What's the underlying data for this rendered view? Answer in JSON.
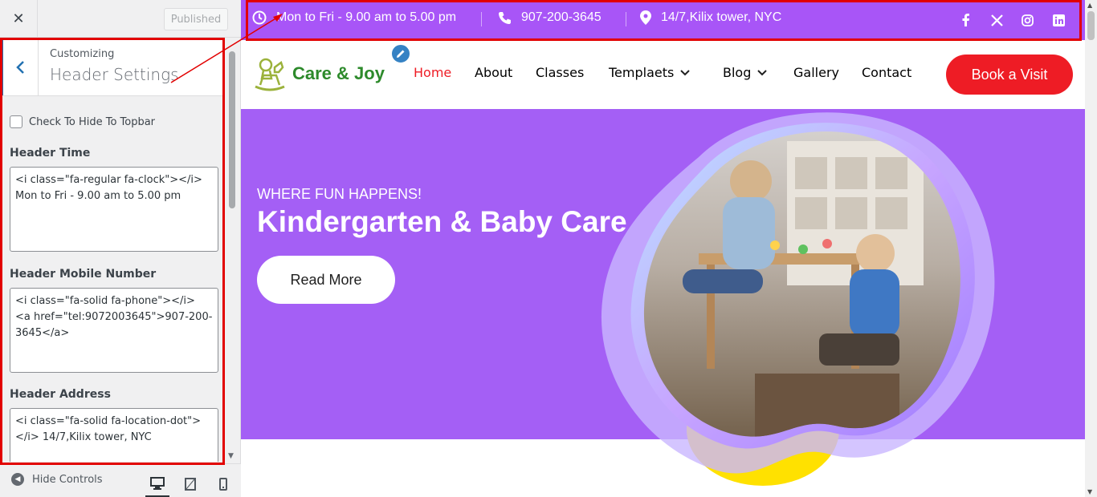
{
  "customizer": {
    "close_label": "✕",
    "published_label": "Published",
    "breadcrumb": "Customizing",
    "panel_title": "Header Settings",
    "hide_topbar_label": "Check To Hide To Topbar",
    "fields": [
      {
        "label": "Header Time",
        "value": "<i class=\"fa-regular fa-clock\"></i> Mon to Fri - 9.00 am to 5.00 pm"
      },
      {
        "label": "Header Mobile Number",
        "value": "<i class=\"fa-solid fa-phone\"></i> <a href=\"tel:9072003645\">907-200-3645</a>"
      },
      {
        "label": "Header Address",
        "value": "<i class=\"fa-solid fa-location-dot\"></i> 14/7,Kilix tower, NYC"
      }
    ],
    "hide_controls_label": "Hide Controls"
  },
  "topbar": {
    "time": "Mon to Fri - 9.00 am to 5.00 pm",
    "phone": "907-200-3645",
    "address": "14/7,Kilix tower, NYC",
    "social": [
      "facebook-icon",
      "x-icon",
      "instagram-icon",
      "linkedin-icon"
    ]
  },
  "header": {
    "logo_text": "Care & Joy",
    "nav": [
      "Home",
      "About",
      "Classes",
      "Templaets",
      "Blog",
      "Gallery",
      "Contact"
    ],
    "cta_label": "Book a Visit"
  },
  "hero": {
    "subtitle": "WHERE FUN HAPPENS!",
    "title": "Kindergarten & Baby Care",
    "button_label": "Read More"
  },
  "colors": {
    "topbar_bg": "#a855f7",
    "hero_bg": "#a45ff5",
    "accent_red": "#ee1c25",
    "logo_green": "#2d8a2b",
    "wp_blue": "#2271b1"
  }
}
